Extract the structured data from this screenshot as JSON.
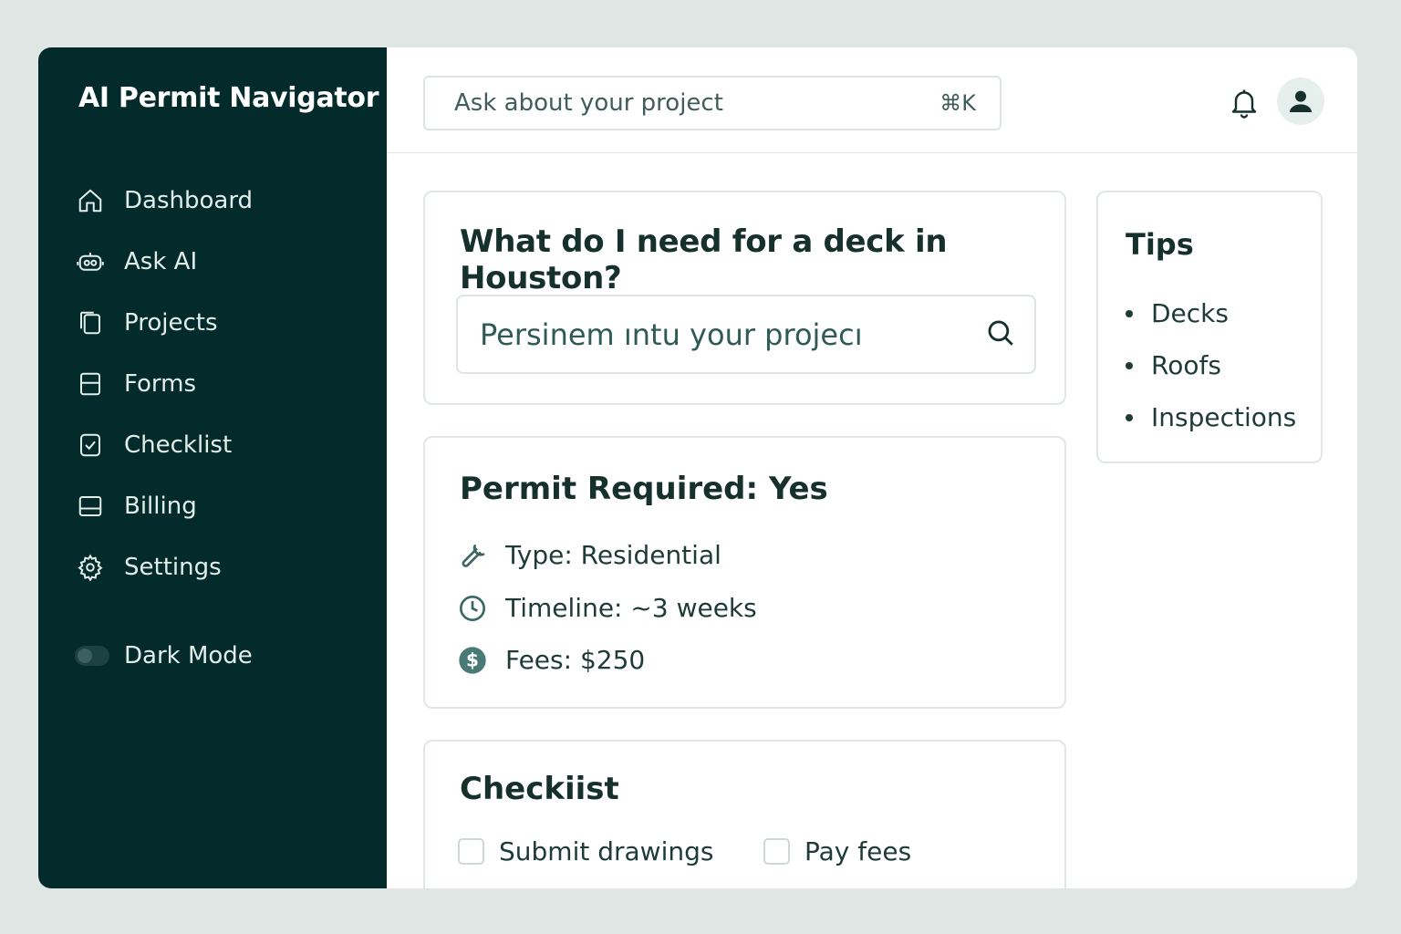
{
  "app": {
    "title": "AI Permit Navigator"
  },
  "sidebar": {
    "items": [
      {
        "label": "Dashboard",
        "icon": "home-icon"
      },
      {
        "label": "Ask AI",
        "icon": "robot-icon"
      },
      {
        "label": "Projects",
        "icon": "copy-icon"
      },
      {
        "label": "Forms",
        "icon": "form-icon"
      },
      {
        "label": "Checklist",
        "icon": "check-square-icon"
      },
      {
        "label": "Billing",
        "icon": "card-icon"
      },
      {
        "label": "Settings",
        "icon": "gear-icon"
      }
    ],
    "dark_mode": {
      "label": "Dark Mode",
      "enabled": false
    }
  },
  "topbar": {
    "search_placeholder": "Ask about your project",
    "shortcut": "⌘K",
    "icons": [
      "bell-icon",
      "user-avatar-icon"
    ]
  },
  "question_card": {
    "title": "What do I need for a deck in Houston?",
    "input_value": "Persinem ıntu your projecı",
    "icon": "search-icon"
  },
  "permit_card": {
    "title": "Permit Required: Yes",
    "rows": [
      {
        "icon": "wrench-icon",
        "text": "Type: Residential"
      },
      {
        "icon": "clock-icon",
        "text": "Timeline: ~3 weeks"
      },
      {
        "icon": "dollar-icon",
        "text": "Fees: $250"
      }
    ]
  },
  "checklist_card": {
    "title": "Checkiist",
    "items": [
      {
        "label": "Submit drawings",
        "checked": false
      },
      {
        "label": "Pay fees",
        "checked": false
      }
    ]
  },
  "tips_card": {
    "title": "Tips",
    "items": [
      "Decks",
      "Roofs",
      "Inspections"
    ]
  },
  "colors": {
    "sidebar_bg": "#032b2b",
    "page_bg": "#dfe6e4",
    "text_dark": "#16302b"
  }
}
